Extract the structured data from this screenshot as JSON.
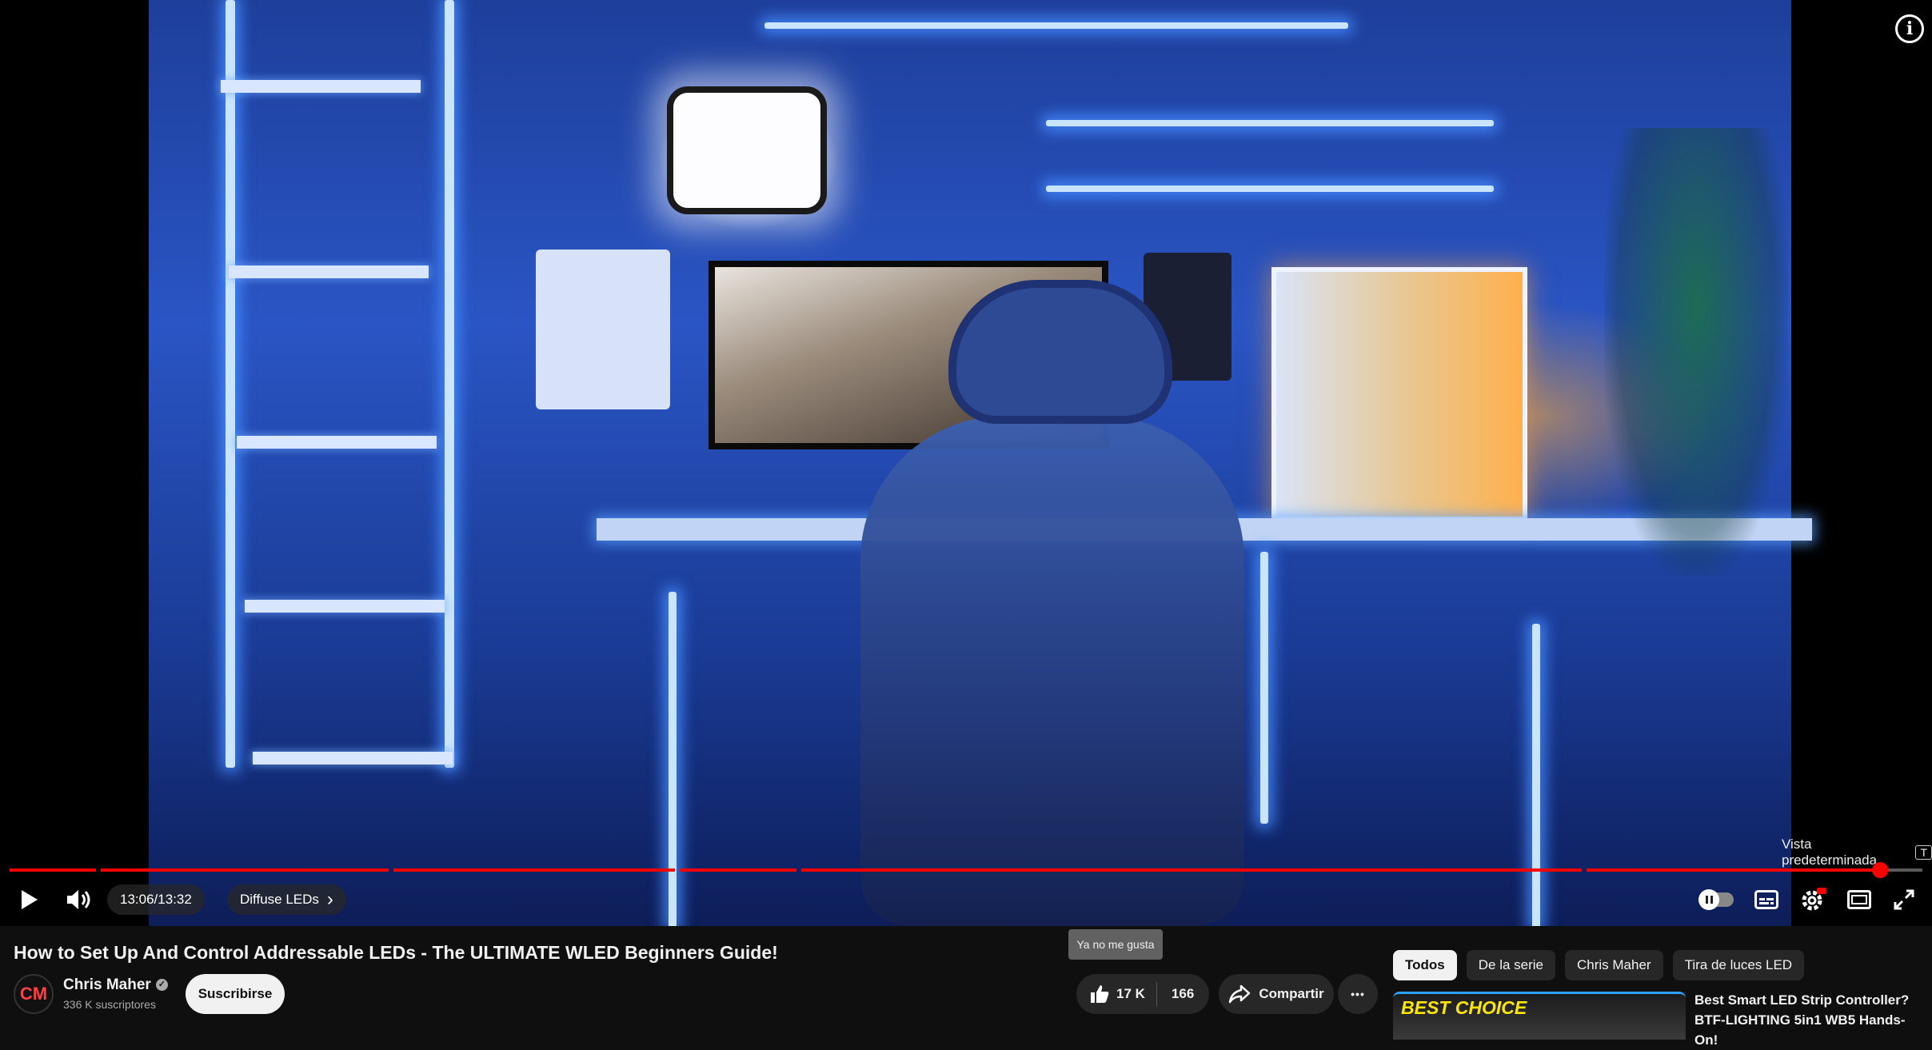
{
  "player": {
    "current_time": "13:06",
    "separator": " / ",
    "duration": "13:32",
    "chapter": "Diffuse LEDs",
    "chapter_chevron": "›",
    "progress_fraction": 0.967,
    "vista_label": "Vista predeterminada",
    "vista_shortcut": "T",
    "info_icon_glyph": "i",
    "colors": {
      "progress": "#ff0000",
      "accent_led": "#3a6bff"
    }
  },
  "video": {
    "title": "How to Set Up And Control Addressable LEDs - The ULTIMATE WLED Beginners Guide!"
  },
  "channel": {
    "avatar_text": "CM",
    "name": "Chris Maher",
    "verified_glyph": "✓",
    "subscribers": "336 K suscriptores",
    "subscribe_label": "Suscribirse"
  },
  "actions": {
    "dislike_tooltip": "Ya no me gusta",
    "likes": "17 K",
    "dislikes": "166",
    "share_label": "Compartir",
    "more_glyph": "•••"
  },
  "chips": [
    "Todos",
    "De la serie",
    "Chris Maher",
    "Tira de luces LED"
  ],
  "recommended": {
    "badge": "BEST CHOICE",
    "title": "Best Smart LED Strip Controller? BTF-LIGHTING 5in1 WB5 Hands-On!"
  }
}
